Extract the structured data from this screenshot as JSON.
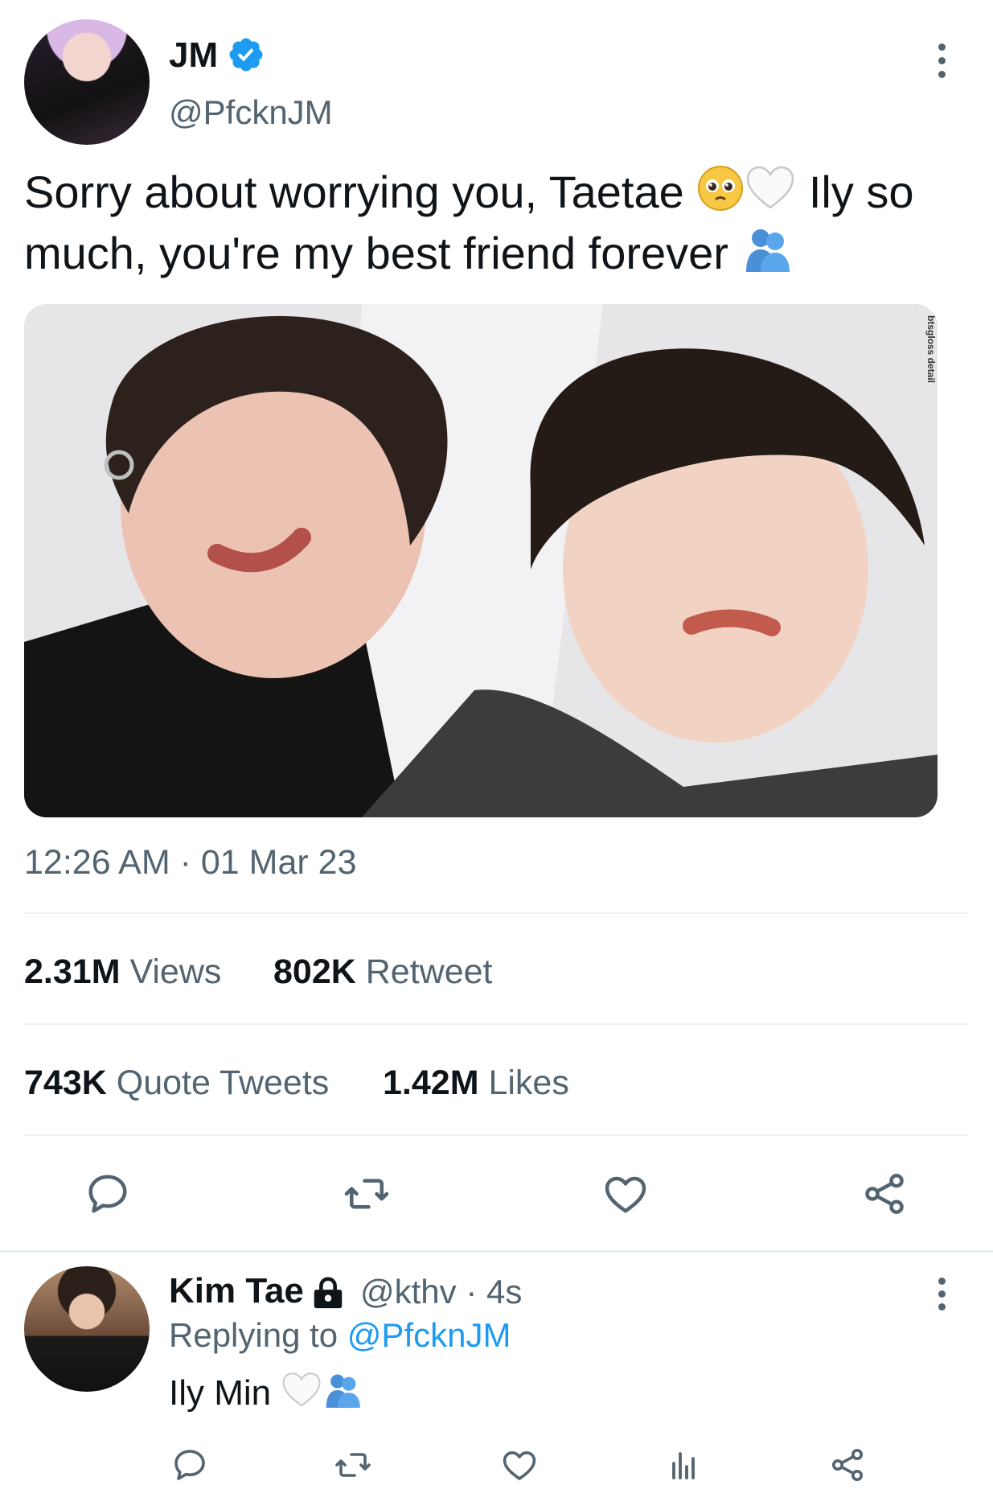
{
  "tweet": {
    "author_name": "JM",
    "author_handle": "@PfcknJM",
    "text_line1": "Sorry about worrying you, Taetae ",
    "text_line1_end": " Ily so",
    "text_line2": "much, you're my best friend forever ",
    "timestamp": "12:26 AM · 01 Mar 23",
    "photo_watermark": "btsgloss detail",
    "stats": {
      "views_count": "2.31M",
      "views_label": "Views",
      "retweet_count": "802K",
      "retweet_label": "Retweet",
      "quote_count": "743K",
      "quote_label": "Quote Tweets",
      "likes_count": "1.42M",
      "likes_label": "Likes"
    }
  },
  "reply": {
    "author_name": "Kim Tae",
    "author_handle": "@kthv",
    "time": " · 4s",
    "replying_prefix": "Replying to ",
    "replying_handle": "@PfcknJM",
    "text": "Ily Min"
  },
  "colors": {
    "accent": "#1d9bf0",
    "secondary_text": "#536471",
    "primary_text": "#0f1419",
    "divider": "#eff3f4"
  },
  "icons": [
    "verified-icon",
    "more-icon",
    "pleading-face-emoji",
    "white-heart-emoji",
    "people-hugging-emoji",
    "reply-icon",
    "retweet-icon",
    "like-icon",
    "share-icon",
    "lock-icon",
    "analytics-icon"
  ]
}
